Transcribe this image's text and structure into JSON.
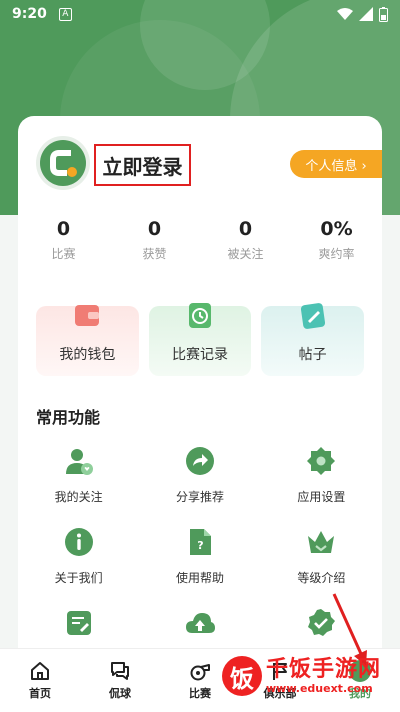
{
  "status_bar": {
    "time": "9:20",
    "badge": "A"
  },
  "profile": {
    "login_label": "立即登录",
    "info_button": "个人信息 ›"
  },
  "stats": [
    {
      "value": "0",
      "label": "比赛"
    },
    {
      "value": "0",
      "label": "获赞"
    },
    {
      "value": "0",
      "label": "被关注"
    },
    {
      "value": "0%",
      "label": "爽约率"
    }
  ],
  "quick_actions": [
    {
      "label": "我的钱包",
      "icon": "wallet-icon"
    },
    {
      "label": "比赛记录",
      "icon": "clock-icon"
    },
    {
      "label": "帖子",
      "icon": "edit-icon"
    }
  ],
  "section_title": "常用功能",
  "features": [
    {
      "label": "我的关注",
      "icon": "user-heart-icon"
    },
    {
      "label": "分享推荐",
      "icon": "share-icon"
    },
    {
      "label": "应用设置",
      "icon": "gear-icon"
    },
    {
      "label": "关于我们",
      "icon": "info-icon"
    },
    {
      "label": "使用帮助",
      "icon": "help-doc-icon"
    },
    {
      "label": "等级介绍",
      "icon": "crown-icon"
    },
    {
      "label": "",
      "icon": "note-edit-icon"
    },
    {
      "label": "",
      "icon": "cloud-upload-icon"
    },
    {
      "label": "",
      "icon": "badge-check-icon"
    }
  ],
  "bottom_nav": [
    {
      "label": "首页",
      "icon": "home-icon"
    },
    {
      "label": "侃球",
      "icon": "chat-icon"
    },
    {
      "label": "比赛",
      "icon": "whistle-icon"
    },
    {
      "label": "俱乐部",
      "icon": "flag-icon"
    },
    {
      "label": "我的",
      "icon": "profile-icon"
    }
  ],
  "watermark": {
    "char": "饭",
    "title": "千饭手游网",
    "url": "www.eduext.com"
  },
  "colors": {
    "brand_green": "#4f9a5b",
    "accent_orange": "#f5a623",
    "highlight_red": "#e02020"
  }
}
